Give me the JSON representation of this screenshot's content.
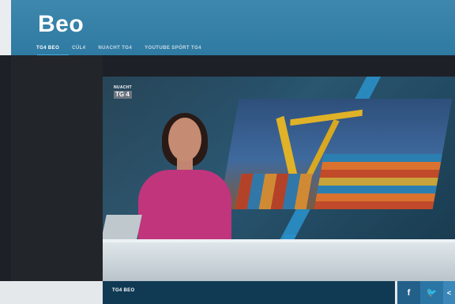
{
  "header": {
    "logo": "Beo",
    "tabs": [
      {
        "label": "TG4 BEO",
        "active": true
      },
      {
        "label": "CÚL4",
        "active": false
      },
      {
        "label": "NUACHT TG4",
        "active": false
      },
      {
        "label": "YOUTUBE SPÓRT TG4",
        "active": false
      }
    ]
  },
  "player": {
    "channel_logo_top": "NUACHT",
    "channel_logo_bottom": "TG 4",
    "controls_text": "⋯  ⚙  ⤢"
  },
  "footer": {
    "label": "TG4 BEO",
    "share": {
      "facebook": "f",
      "twitter": "🐦",
      "more": "<"
    }
  },
  "colors": {
    "header": "#3e87ad",
    "accent": "#46b0e4",
    "footer_bar": "#103a54"
  }
}
